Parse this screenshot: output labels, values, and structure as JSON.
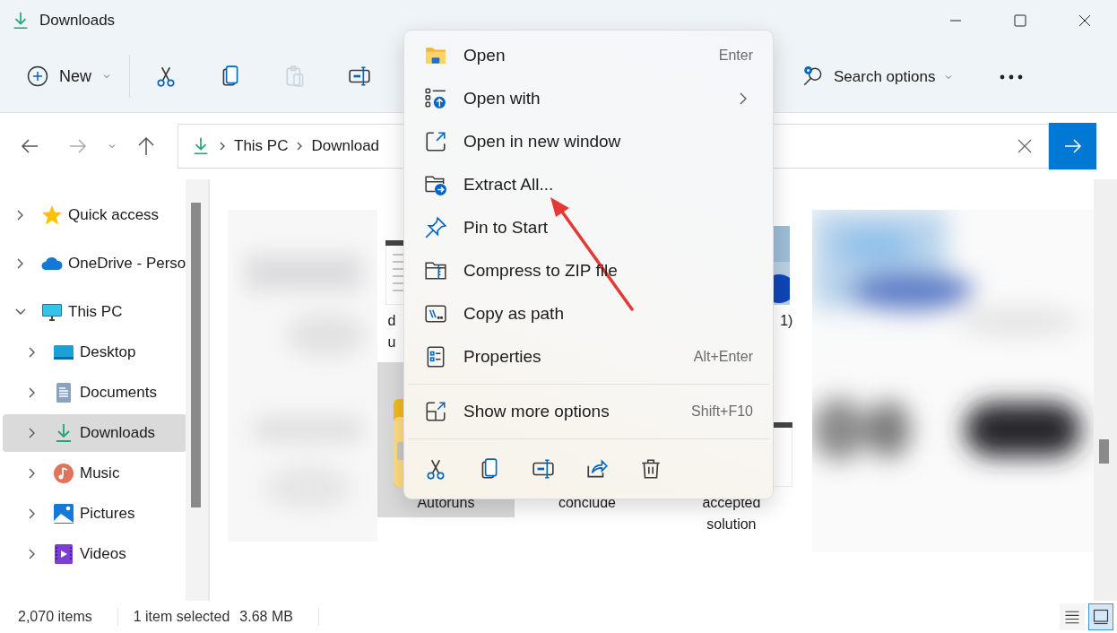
{
  "window": {
    "title": "Downloads"
  },
  "toolbar": {
    "new_label": "New",
    "actions": [
      {
        "kind": "cut",
        "disabled": false
      },
      {
        "kind": "copy",
        "disabled": false
      },
      {
        "kind": "paste",
        "disabled": true
      },
      {
        "kind": "rename",
        "disabled": false
      }
    ],
    "search_options": "Search options"
  },
  "address": {
    "crumbs": [
      "This PC",
      "Download"
    ]
  },
  "sidebar": {
    "items": [
      {
        "label": "Quick access",
        "kind": "star",
        "expanded": false,
        "selected": false
      },
      {
        "label": "OneDrive - Perso",
        "kind": "cloud",
        "expanded": false,
        "selected": false
      },
      {
        "label": "This PC",
        "kind": "monitor",
        "expanded": true,
        "selected": false,
        "children": [
          {
            "label": "Desktop",
            "kind": "desktop",
            "expanded": false,
            "selected": false
          },
          {
            "label": "Documents",
            "kind": "documents",
            "expanded": false,
            "selected": false
          },
          {
            "label": "Downloads",
            "kind": "download",
            "expanded": false,
            "selected": true
          },
          {
            "label": "Music",
            "kind": "music",
            "expanded": false,
            "selected": false
          },
          {
            "label": "Pictures",
            "kind": "pictures",
            "expanded": false,
            "selected": false
          },
          {
            "label": "Videos",
            "kind": "videos",
            "expanded": false,
            "selected": false
          }
        ]
      }
    ]
  },
  "files": [
    {
      "lines": [
        "d",
        "u"
      ],
      "kind": "document",
      "selected": false
    },
    {
      "lines": [
        "1)"
      ],
      "selected": false
    },
    {
      "lines": [
        "Autoruns"
      ],
      "kind": "zip",
      "selected": true
    },
    {
      "lines": [
        "conclude"
      ],
      "selected": false
    },
    {
      "lines": [
        "accepted",
        "solution"
      ],
      "kind": "document",
      "selected": false
    }
  ],
  "context_menu": {
    "items": [
      {
        "label": "Open",
        "kind": "open",
        "shortcut": "Enter"
      },
      {
        "label": "Open with",
        "kind": "open-with",
        "submenu": true
      },
      {
        "label": "Open in new window",
        "kind": "new-window"
      },
      {
        "label": "Extract All...",
        "kind": "extract"
      },
      {
        "label": "Pin to Start",
        "kind": "pin"
      },
      {
        "label": "Compress to ZIP file",
        "kind": "compress"
      },
      {
        "label": "Copy as path",
        "kind": "copy-path"
      },
      {
        "label": "Properties",
        "kind": "properties",
        "shortcut": "Alt+Enter"
      }
    ],
    "more": {
      "label": "Show more options",
      "kind": "more-options",
      "shortcut": "Shift+F10"
    },
    "quick_actions": [
      {
        "kind": "cut"
      },
      {
        "kind": "copy"
      },
      {
        "kind": "rename"
      },
      {
        "kind": "share"
      },
      {
        "kind": "delete"
      }
    ]
  },
  "status_bar": {
    "count": "2,070 items",
    "selection": "1 item selected",
    "size": "3.68 MB",
    "views": [
      {
        "kind": "details",
        "selected": false
      },
      {
        "kind": "large-icons",
        "selected": true
      }
    ]
  }
}
